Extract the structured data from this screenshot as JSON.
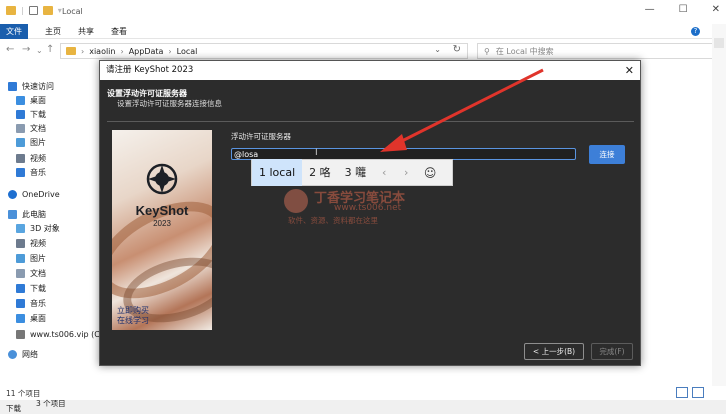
{
  "explorer": {
    "title": "Local",
    "win_buttons": [
      "—",
      "☐",
      "✕"
    ],
    "ribbon_tabs": [
      "文件",
      "主页",
      "共享",
      "查看"
    ],
    "help": "?",
    "breadcrumb": [
      "xiaolin",
      "AppData",
      "Local"
    ],
    "search_placeholder": "在 Local 中搜索",
    "sidebar": [
      {
        "label": "快速访问",
        "icon": "star-icon",
        "color": "#2f7ad6"
      },
      {
        "label": "桌面",
        "icon": "desktop-icon",
        "color": "#3b8ee0"
      },
      {
        "label": "下载",
        "icon": "download-icon",
        "color": "#2f7ad6"
      },
      {
        "label": "文档",
        "icon": "document-icon",
        "color": "#8a9bb0"
      },
      {
        "label": "图片",
        "icon": "picture-icon",
        "color": "#4d9bd8"
      },
      {
        "label": "视频",
        "icon": "video-icon",
        "color": "#6d7b8e"
      },
      {
        "label": "音乐",
        "icon": "music-icon",
        "color": "#2f7ad6"
      },
      {
        "label": "OneDrive",
        "icon": "cloud-icon",
        "color": "#1e6fd0"
      },
      {
        "label": "此电脑",
        "icon": "computer-icon",
        "color": "#4a90d9"
      },
      {
        "label": "3D 对象",
        "icon": "cube-icon",
        "color": "#59a5e0"
      },
      {
        "label": "视频",
        "icon": "video-icon",
        "color": "#6d7b8e"
      },
      {
        "label": "图片",
        "icon": "picture-icon",
        "color": "#4d9bd8"
      },
      {
        "label": "文档",
        "icon": "document-icon",
        "color": "#8a9bb0"
      },
      {
        "label": "下载",
        "icon": "download-icon",
        "color": "#2f7ad6"
      },
      {
        "label": "音乐",
        "icon": "music-icon",
        "color": "#2f7ad6"
      },
      {
        "label": "桌面",
        "icon": "desktop-icon",
        "color": "#3b8ee0"
      },
      {
        "label": "www.ts006.vip (C",
        "icon": "drive-icon",
        "color": "#777777"
      },
      {
        "label": "网络",
        "icon": "network-icon",
        "color": "#4a90d9"
      }
    ],
    "status_count": "11 个项目",
    "taskbar_text_1": "下载",
    "taskbar_text_2": "3 个项目"
  },
  "dialog": {
    "title": "请注册 KeyShot 2023",
    "close": "✕",
    "heading": "设置浮动许可证服务器",
    "subheading": "设置浮动许可证服务器连接信息",
    "splash_name": "KeyShot",
    "splash_year": "2023",
    "splash_promo_line1": "立即购买",
    "splash_promo_line2": "在线学习",
    "field_label": "浮动许可证服务器",
    "field_value": "@losa",
    "connect_label": "连接",
    "back_label": "< 上一步(B)",
    "finish_label": "完成(F)"
  },
  "ime": {
    "candidates": [
      {
        "num": "1",
        "text": "local",
        "selected": true
      },
      {
        "num": "2",
        "text": "咯",
        "selected": false
      },
      {
        "num": "3",
        "text": "囖",
        "selected": false
      }
    ],
    "prev": "‹",
    "next": "›",
    "emoji": "☺"
  },
  "watermark": {
    "title": "丁香学习笔记本",
    "url": "www.ts006.net",
    "tagline": "软件、资源、资料都在这里"
  },
  "colors": {
    "accent": "#3d7fd8",
    "arrow": "#e0342b",
    "dialog_bg": "#2c2c2c",
    "file_tab": "#1a5ead"
  }
}
